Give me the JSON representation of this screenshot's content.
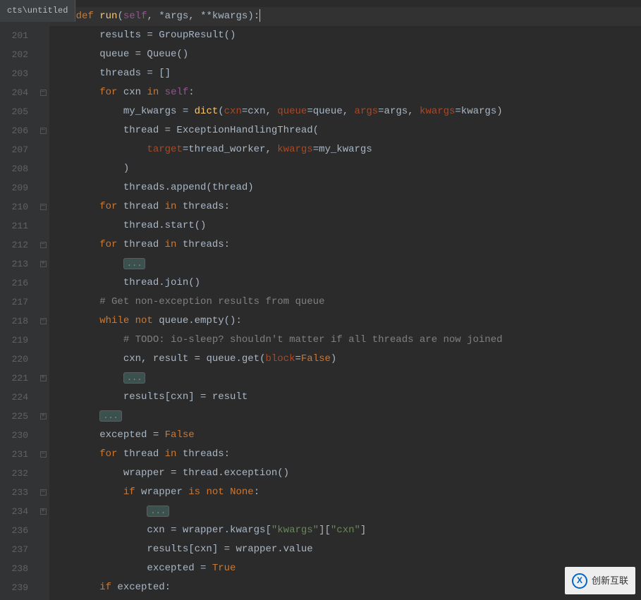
{
  "tab": {
    "label": "cts\\untitled"
  },
  "code": {
    "lines": [
      {
        "no": "",
        "fold": "-",
        "html": "    <span class='kw'>def</span> <span class='fn'>run</span>(<span class='self'>self</span><span class='op'>,</span> *args<span class='op'>,</span> **kwargs):<span class='cursor'></span>"
      },
      {
        "no": "201",
        "fold": "",
        "html": "        results = GroupResult()"
      },
      {
        "no": "202",
        "fold": "",
        "html": "        queue = Queue()"
      },
      {
        "no": "203",
        "fold": "",
        "html": "        threads = []"
      },
      {
        "no": "204",
        "fold": "-",
        "html": "        <span class='kw'>for</span> cxn <span class='kw'>in</span> <span class='self'>self</span>:"
      },
      {
        "no": "205",
        "fold": "",
        "html": "            my_kwargs = <span class='fn'>dict</span>(<span class='pname'>cxn</span>=cxn<span class='op'>,</span> <span class='pname'>queue</span>=queue<span class='op'>,</span> <span class='pname'>args</span>=args<span class='op'>,</span> <span class='pname'>kwargs</span>=kwargs)"
      },
      {
        "no": "206",
        "fold": "-",
        "html": "            thread = ExceptionHandlingThread("
      },
      {
        "no": "207",
        "fold": "",
        "html": "                <span class='pname'>target</span>=thread_worker<span class='op'>,</span> <span class='pname'>kwargs</span>=my_kwargs"
      },
      {
        "no": "208",
        "fold": "",
        "html": "            )"
      },
      {
        "no": "209",
        "fold": "",
        "html": "            threads.append(thread)"
      },
      {
        "no": "210",
        "fold": "-",
        "html": "        <span class='kw'>for</span> thread <span class='kw'>in</span> threads:"
      },
      {
        "no": "211",
        "fold": "",
        "html": "            thread.start()"
      },
      {
        "no": "212",
        "fold": "-",
        "html": "        <span class='kw'>for</span> thread <span class='kw'>in</span> threads:"
      },
      {
        "no": "213",
        "fold": "+",
        "html": "            <span class='fold-box'>...</span>"
      },
      {
        "no": "216",
        "fold": "",
        "html": "            thread.join()"
      },
      {
        "no": "217",
        "fold": "",
        "html": "        <span class='cmt'># Get non-exception results from queue</span>"
      },
      {
        "no": "218",
        "fold": "-",
        "html": "        <span class='kw'>while not</span> queue.empty():"
      },
      {
        "no": "219",
        "fold": "",
        "html": "            <span class='cmt'># TODO: io-sleep? shouldn't matter if all threads are now joined</span>"
      },
      {
        "no": "220",
        "fold": "",
        "html": "            cxn<span class='op'>,</span> result = queue.get(<span class='pname'>block</span>=<span class='bool'>False</span>)"
      },
      {
        "no": "221",
        "fold": "+",
        "html": "            <span class='fold-box'>...</span>"
      },
      {
        "no": "224",
        "fold": "",
        "html": "            results[cxn] = result"
      },
      {
        "no": "225",
        "fold": "+",
        "html": "        <span class='fold-box'>...</span>"
      },
      {
        "no": "230",
        "fold": "",
        "html": "        excepted = <span class='bool'>False</span>"
      },
      {
        "no": "231",
        "fold": "-",
        "html": "        <span class='kw'>for</span> thread <span class='kw'>in</span> threads:"
      },
      {
        "no": "232",
        "fold": "",
        "html": "            wrapper = thread.exception()"
      },
      {
        "no": "233",
        "fold": "-",
        "html": "            <span class='kw'>if</span> wrapper <span class='kw'>is not</span> <span class='bool'>None</span>:"
      },
      {
        "no": "234",
        "fold": "+",
        "html": "                <span class='fold-box'>...</span>"
      },
      {
        "no": "236",
        "fold": "",
        "html": "                cxn = wrapper.kwargs[<span class='s'>\"kwargs\"</span>][<span class='s'>\"cxn\"</span>]"
      },
      {
        "no": "237",
        "fold": "",
        "html": "                results[cxn] = wrapper.value"
      },
      {
        "no": "238",
        "fold": "",
        "html": "                excepted = <span class='bool'>True</span>"
      },
      {
        "no": "239",
        "fold": "",
        "html": "        <span class='kw'>if</span> excepted:"
      }
    ]
  },
  "watermark": {
    "text": "创新互联",
    "logo_letter": "X"
  }
}
